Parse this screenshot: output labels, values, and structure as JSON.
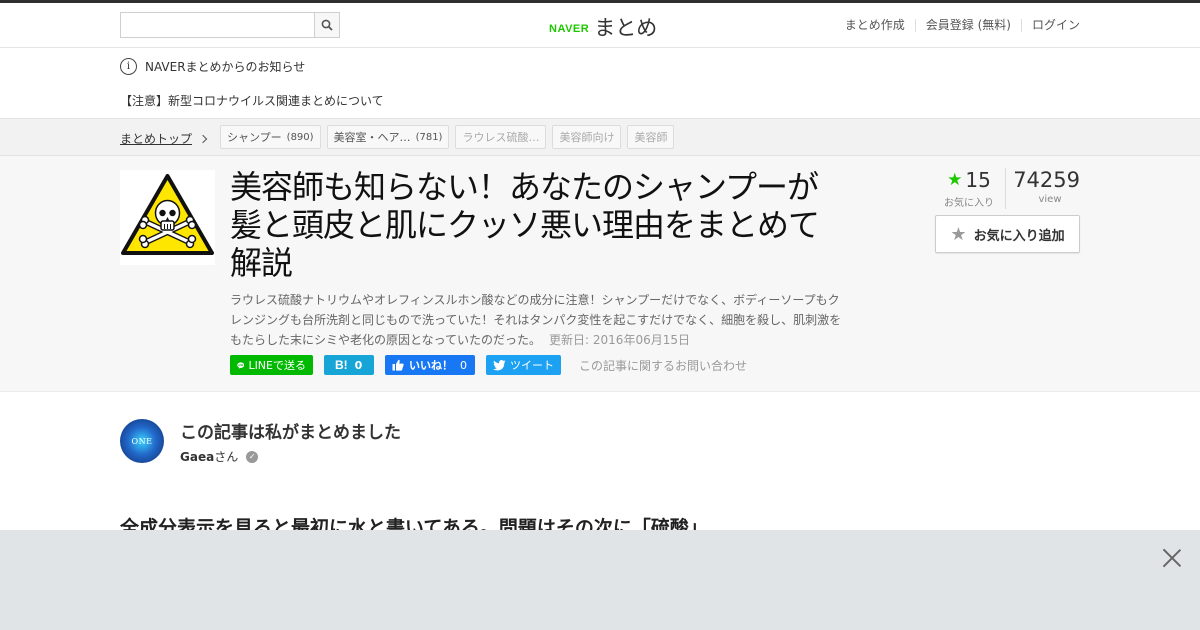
{
  "header": {
    "search_placeholder": "",
    "search_value": "",
    "logo_brand": "NAVER",
    "logo_name": "まとめ",
    "nav": [
      "まとめ作成",
      "会員登録 (無料)",
      "ログイン"
    ]
  },
  "notice": {
    "info_icon": "i",
    "title": "NAVERまとめからのお知らせ",
    "item": "【注意】新型コロナウイルス関連まとめについて"
  },
  "breadcrumb": {
    "top_label": "まとめトップ",
    "tags": [
      {
        "label": "シャンプー",
        "count": "(890)"
      },
      {
        "label": "美容室・ヘア…",
        "count": "(781)"
      },
      {
        "label": "ラウレス硫酸…",
        "count": ""
      },
      {
        "label": "美容師向け",
        "count": ""
      },
      {
        "label": "美容師",
        "count": ""
      }
    ]
  },
  "article": {
    "title": "美容師も知らない！あなたのシャンプーが髪と頭皮と肌にクッソ悪い理由をまとめて解説",
    "description": "ラウレス硫酸ナトリウムやオレフィンスルホン酸などの成分に注意！シャンプーだけでなく、ボディーソープもクレンジングも台所洗剤と同じもので洗っていた！それはタンパク変性を起こすだけでなく、細胞を殺し、肌刺激をもたらした末にシミや老化の原因となっていたのだった。",
    "updated": "更新日: 2016年06月15日",
    "favorites": "15",
    "favorites_label": "お気に入り",
    "views": "74259",
    "views_label": "view",
    "fav_add_label": "お気に入り追加",
    "share": {
      "line": "LINEで送る",
      "hatena": "B!",
      "hatena_count": "0",
      "fb_label": "いいね！",
      "fb_count": "0",
      "tweet": "ツイート",
      "contact": "この記事に関するお問い合わせ"
    }
  },
  "author": {
    "heading": "この記事は私がまとめました",
    "name": "Gaea",
    "suffix": "さん",
    "avatar_text": "ONE"
  },
  "content": {
    "section_heading": "全成分表示を見ると最初に水と書いてある。問題はその次に「硫酸」"
  },
  "colors": {
    "brand_green": "#1ec800",
    "line_green": "#00b900",
    "hatena_blue": "#17a5d8",
    "facebook_blue": "#1877f2",
    "twitter_blue": "#1da1f2"
  }
}
